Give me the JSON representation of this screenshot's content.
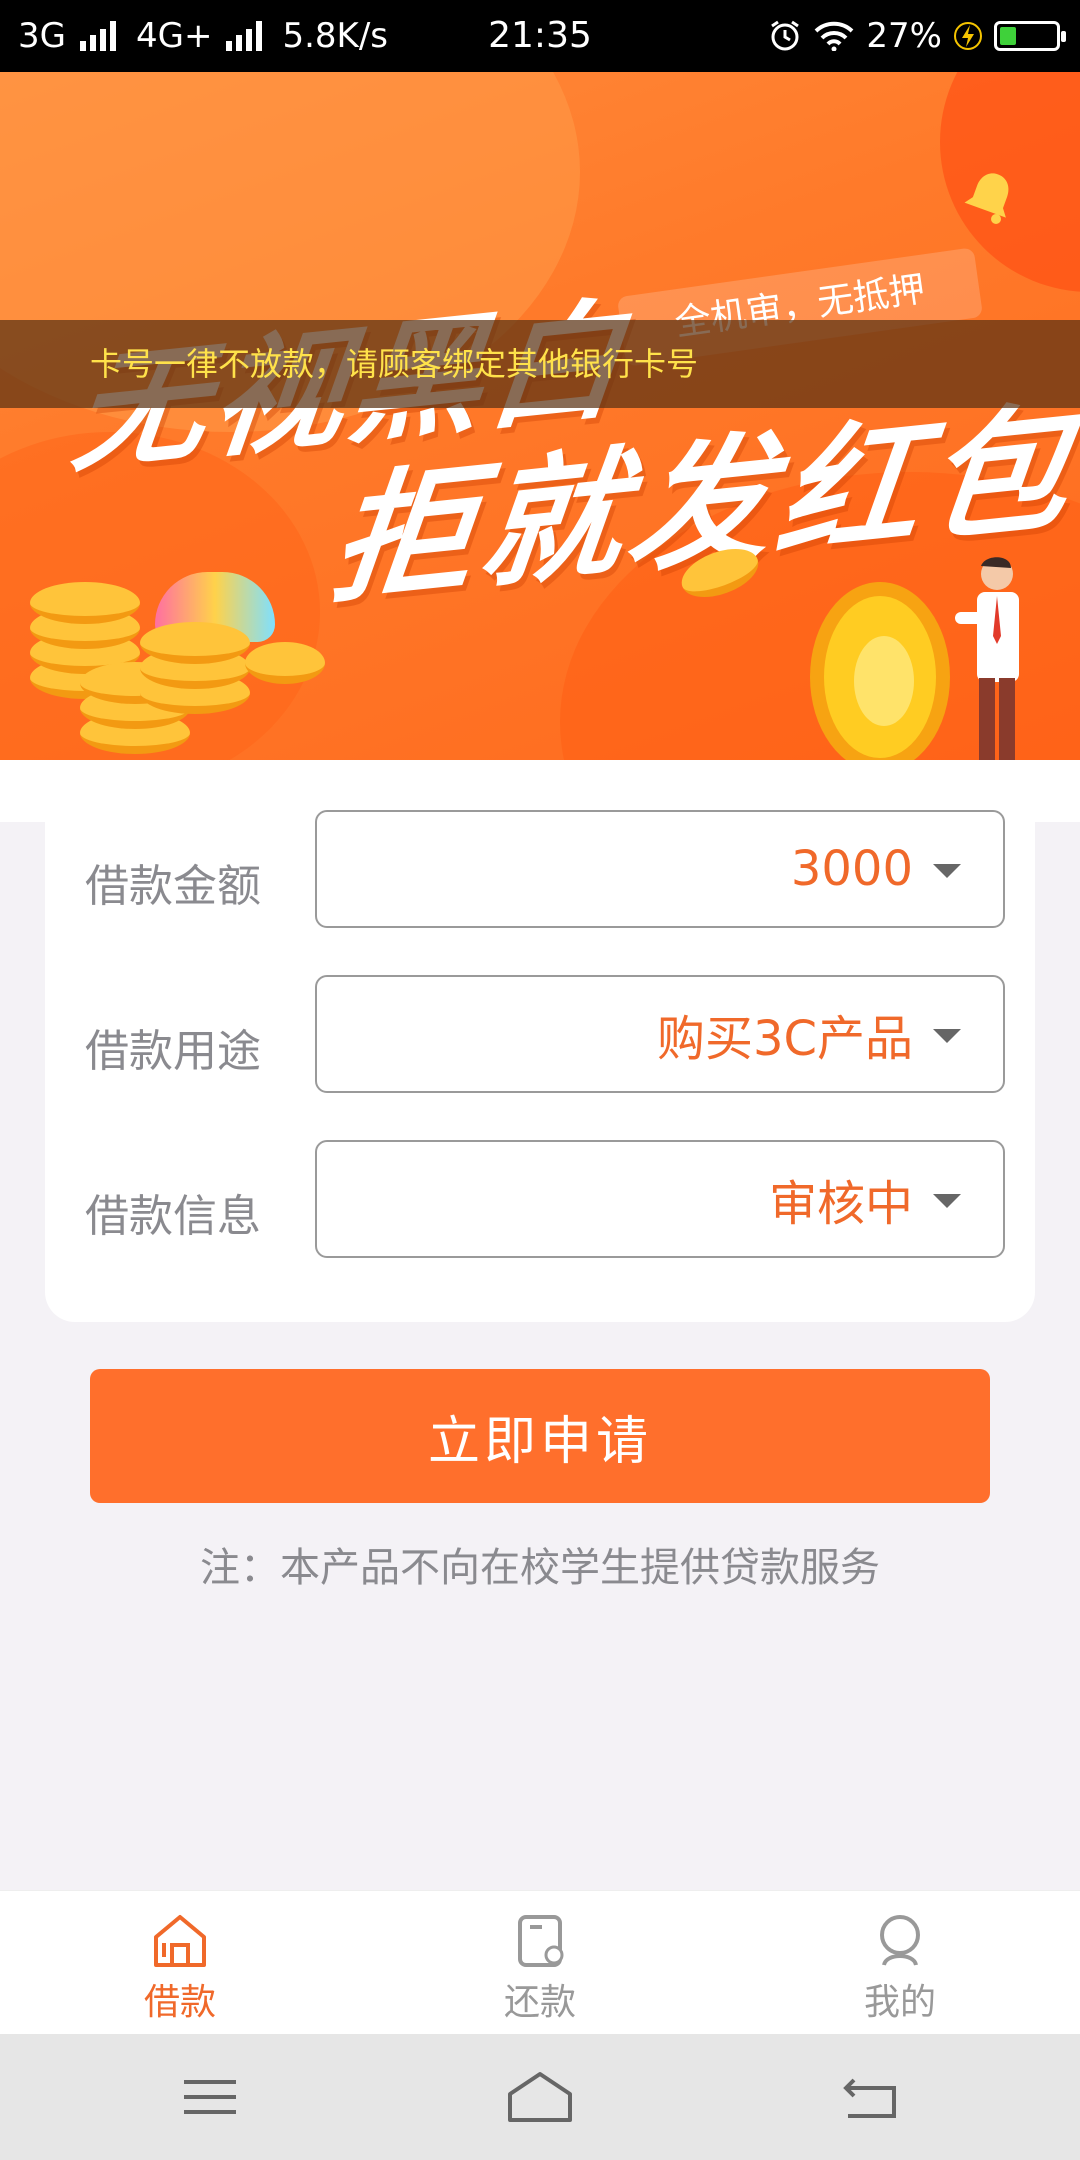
{
  "status_bar": {
    "network1": "3G",
    "network2": "4G+",
    "speed": "5.8K/s",
    "time": "21:35",
    "battery": "27%"
  },
  "banner": {
    "marquee": "卡号一律不放款，请顾客绑定其他银行卡号",
    "headline1": "无视黑白",
    "headline2": "拒就发红包",
    "tag": "全机审，无抵押"
  },
  "form": {
    "rows": [
      {
        "label": "借款金额",
        "value": "3000"
      },
      {
        "label": "借款用途",
        "value": "购买3C产品"
      },
      {
        "label": "借款信息",
        "value": "审核中"
      }
    ]
  },
  "apply_button": "立即申请",
  "note": "注：本产品不向在校学生提供贷款服务",
  "tabs": [
    {
      "label": "借款",
      "active": true
    },
    {
      "label": "还款",
      "active": false
    },
    {
      "label": "我的",
      "active": false
    }
  ],
  "colors": {
    "accent": "#ff6f2c",
    "text_orange": "#f0692a"
  }
}
